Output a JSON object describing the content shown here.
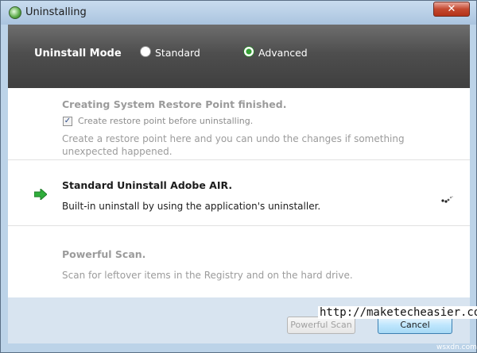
{
  "window": {
    "title": "Uninstalling",
    "close_label": "✕"
  },
  "mode": {
    "label": "Uninstall Mode",
    "options": [
      {
        "label": "Standard",
        "selected": false
      },
      {
        "label": "Advanced",
        "selected": true
      }
    ]
  },
  "steps": [
    {
      "title": "Creating System Restore Point finished.",
      "checkbox_label": "Create restore point before uninstalling.",
      "checkbox_checked": true,
      "description": "Create a restore point here and you can undo the changes if something unexpected happened.",
      "state": "done"
    },
    {
      "title": "Standard Uninstall Adobe AIR.",
      "description": "Built-in uninstall by using the application's uninstaller.",
      "state": "active"
    },
    {
      "title": "Powerful Scan.",
      "description": "Scan for leftover items in the Registry and on the hard drive.",
      "state": "pending"
    }
  ],
  "footer": {
    "powerful_scan_label": "Powerful Scan",
    "cancel_label": "Cancel"
  },
  "watermark": {
    "url": "http://maketecheasier.com",
    "site": "wsxdn.com"
  },
  "icons": {
    "app": "app-logo-icon",
    "current_step": "arrow-right-icon",
    "progress": "loading-spinner-icon"
  },
  "colors": {
    "active_arrow": "#2fae3b",
    "mode_bar": "#4e4e4e",
    "cancel_border": "#3c7fb1"
  }
}
